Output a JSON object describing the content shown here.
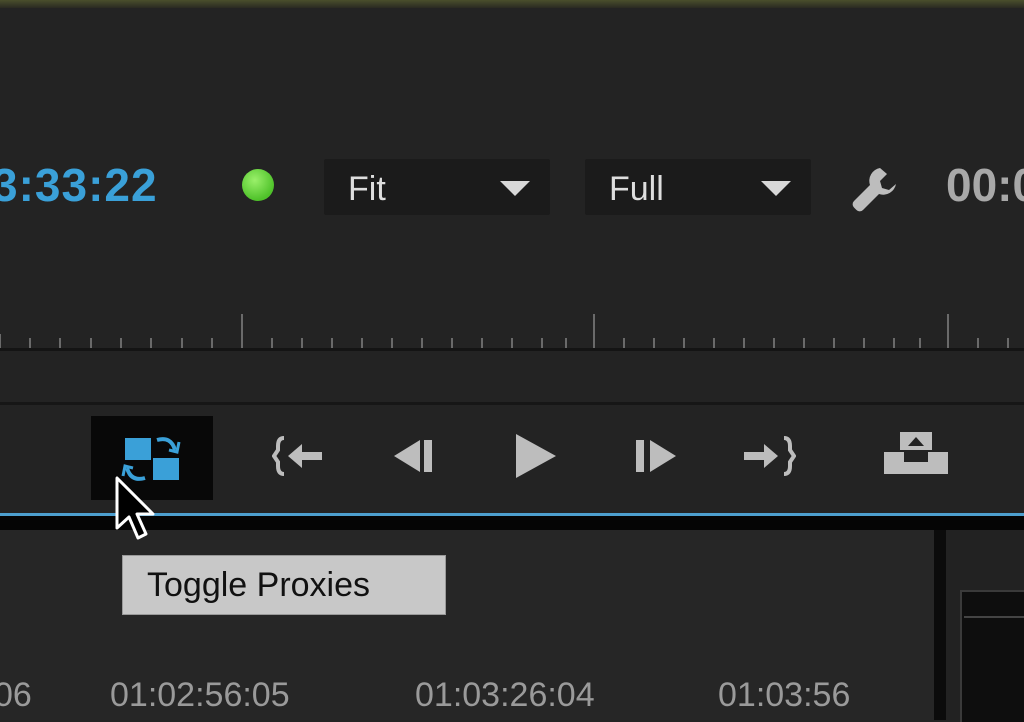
{
  "monitor": {
    "playhead_timecode": "3:33:22",
    "duration_timecode": "00:0",
    "zoom_value": "Fit",
    "quality_value": "Full",
    "status_color": "#5ccf2f"
  },
  "transport": {
    "buttons": [
      {
        "name": "toggle-proxies",
        "icon": "toggle-proxies-icon",
        "active": true,
        "color": "#3aa0d8"
      },
      {
        "name": "go-to-in",
        "icon": "go-to-in-icon"
      },
      {
        "name": "step-back",
        "icon": "step-back-icon"
      },
      {
        "name": "play",
        "icon": "play-icon"
      },
      {
        "name": "step-forward",
        "icon": "step-forward-icon"
      },
      {
        "name": "go-to-out",
        "icon": "go-to-out-icon"
      },
      {
        "name": "lift",
        "icon": "lift-icon"
      }
    ]
  },
  "tooltip": {
    "text": "Toggle Proxies"
  },
  "timeline": {
    "labels": [
      "06",
      "01:02:56:05",
      "01:03:26:04",
      "01:03:56"
    ]
  },
  "colors": {
    "accent": "#3aa0d8",
    "background": "#232323",
    "icon": "#bdbdbd"
  }
}
